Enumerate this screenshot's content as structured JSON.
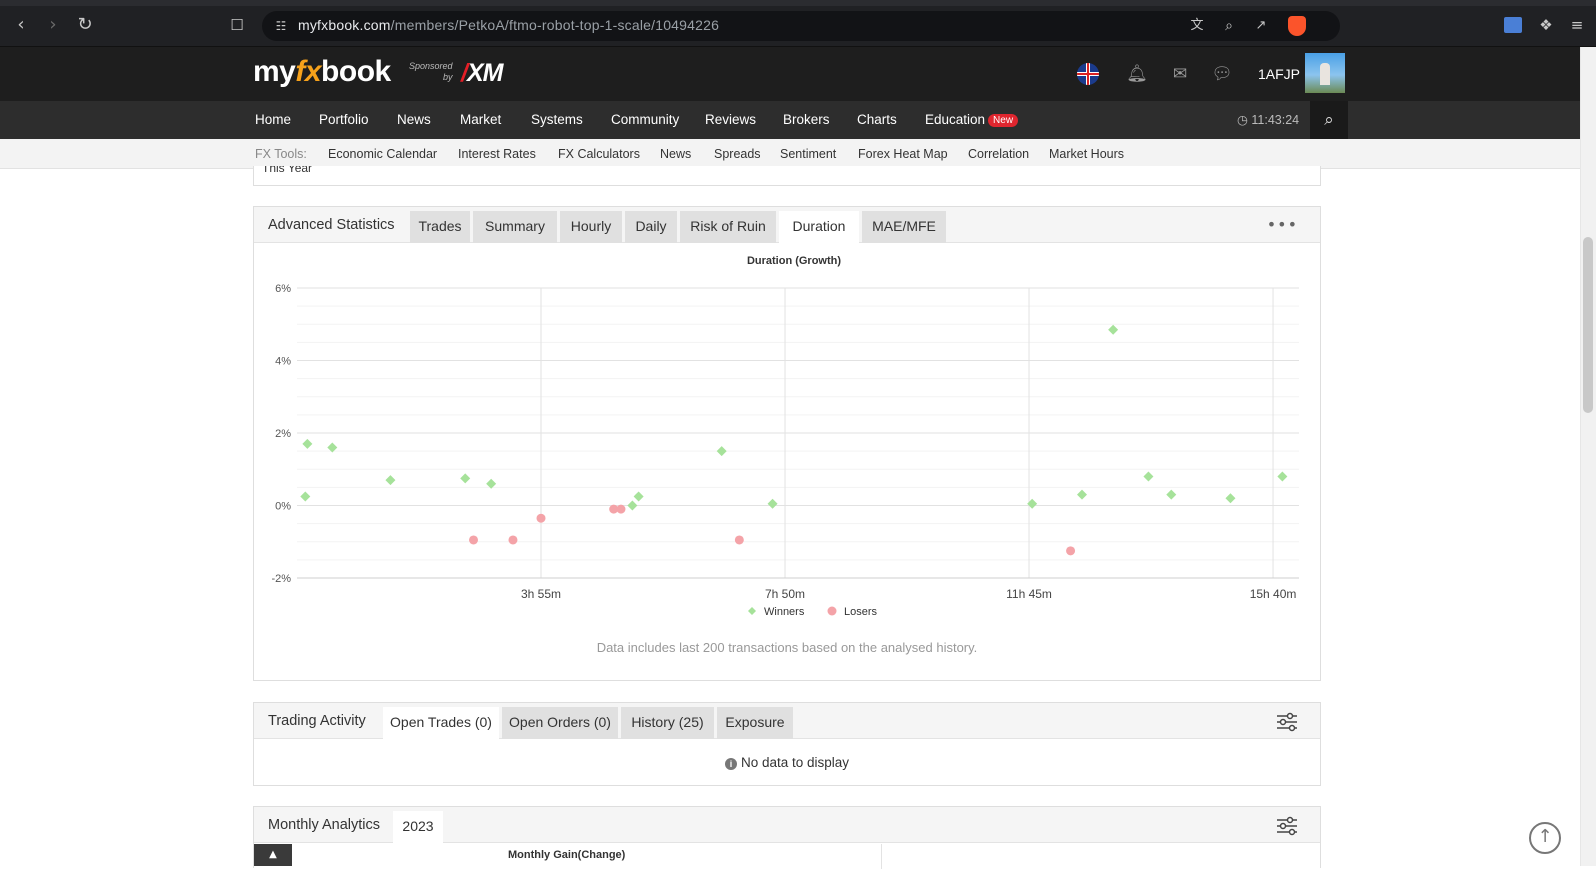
{
  "browser": {
    "url_host": "myfxbook.com",
    "url_path": "/members/PetkoA/ftmo-robot-top-1-scale/10494226"
  },
  "header": {
    "logo_my": "my",
    "logo_fx": "fx",
    "logo_book": "book",
    "sponsored_line1": "Sponsored",
    "sponsored_line2": "by",
    "sponsor": "XM",
    "username": "1AFJP"
  },
  "nav": {
    "items": [
      "Home",
      "Portfolio",
      "News",
      "Market",
      "Systems",
      "Community",
      "Reviews",
      "Brokers",
      "Charts",
      "Education"
    ],
    "new_badge": "New",
    "clock": "11:43:24"
  },
  "tools": {
    "label": "FX Tools:",
    "items": [
      "Economic Calendar",
      "Interest Rates",
      "FX Calculators",
      "News",
      "Spreads",
      "Sentiment",
      "Forex Heat Map",
      "Correlation",
      "Market Hours"
    ]
  },
  "partial_above": "This Year",
  "advanced": {
    "title": "Advanced Statistics",
    "tabs": [
      "Trades",
      "Summary",
      "Hourly",
      "Daily",
      "Risk of Ruin",
      "Duration",
      "MAE/MFE"
    ],
    "active_tab": "Duration",
    "note": "Data includes last 200 transactions based on the analysed history."
  },
  "chart_data": {
    "type": "scatter",
    "title": "Duration (Growth)",
    "xlabel": "",
    "ylabel": "",
    "x_unit": "minutes",
    "xlim": [
      0,
      965
    ],
    "ylim": [
      -2,
      6
    ],
    "x_ticks": [
      {
        "value": 235,
        "label": "3h 55m"
      },
      {
        "value": 470,
        "label": "7h 50m"
      },
      {
        "value": 705,
        "label": "11h 45m"
      },
      {
        "value": 940,
        "label": "15h 40m"
      }
    ],
    "y_ticks": [
      {
        "value": 6,
        "label": "6%"
      },
      {
        "value": 4,
        "label": "4%"
      },
      {
        "value": 2,
        "label": "2%"
      },
      {
        "value": 0,
        "label": "0%"
      },
      {
        "value": -2,
        "label": "-2%"
      }
    ],
    "grid": true,
    "legend_position": "bottom",
    "series": [
      {
        "name": "Winners",
        "color": "#a6e29a",
        "marker": "diamond",
        "points": [
          [
            8,
            0.25
          ],
          [
            10,
            1.7
          ],
          [
            34,
            1.6
          ],
          [
            90,
            0.7
          ],
          [
            162,
            0.75
          ],
          [
            187,
            0.6
          ],
          [
            323,
            0.0
          ],
          [
            329,
            0.25
          ],
          [
            409,
            1.5
          ],
          [
            458,
            0.05
          ],
          [
            708,
            0.05
          ],
          [
            756,
            0.3
          ],
          [
            786,
            4.85
          ],
          [
            820,
            0.8
          ],
          [
            842,
            0.3
          ],
          [
            899,
            0.2
          ],
          [
            949,
            0.8
          ]
        ]
      },
      {
        "name": "Losers",
        "color": "#f4a3a8",
        "marker": "circle",
        "points": [
          [
            170,
            -0.95
          ],
          [
            208,
            -0.95
          ],
          [
            235,
            -0.35
          ],
          [
            305,
            -0.1
          ],
          [
            312,
            -0.1
          ],
          [
            426,
            -0.95
          ],
          [
            745,
            -1.25
          ]
        ]
      }
    ]
  },
  "trading": {
    "title": "Trading Activity",
    "tabs": [
      "Open Trades (0)",
      "Open Orders (0)",
      "History (25)",
      "Exposure"
    ],
    "active_tab": "Open Trades (0)",
    "info_icon_text": "i",
    "no_data": "No data to display"
  },
  "monthly": {
    "title": "Monthly Analytics",
    "year_tab": "2023",
    "chart_title": "Monthly Gain(Change)"
  },
  "icons": {
    "back": "chevron-left-icon",
    "forward": "chevron-right-icon",
    "reload": "reload-icon",
    "bookmark": "bookmark-icon",
    "bell": "bell-icon",
    "mail": "envelope-icon",
    "chat": "chat-icon",
    "search": "search-icon",
    "clock": "clock-icon",
    "more": "more-dots-icon",
    "filter": "filter-sliders-icon",
    "back_to_top": "arrow-up-circle-icon"
  }
}
